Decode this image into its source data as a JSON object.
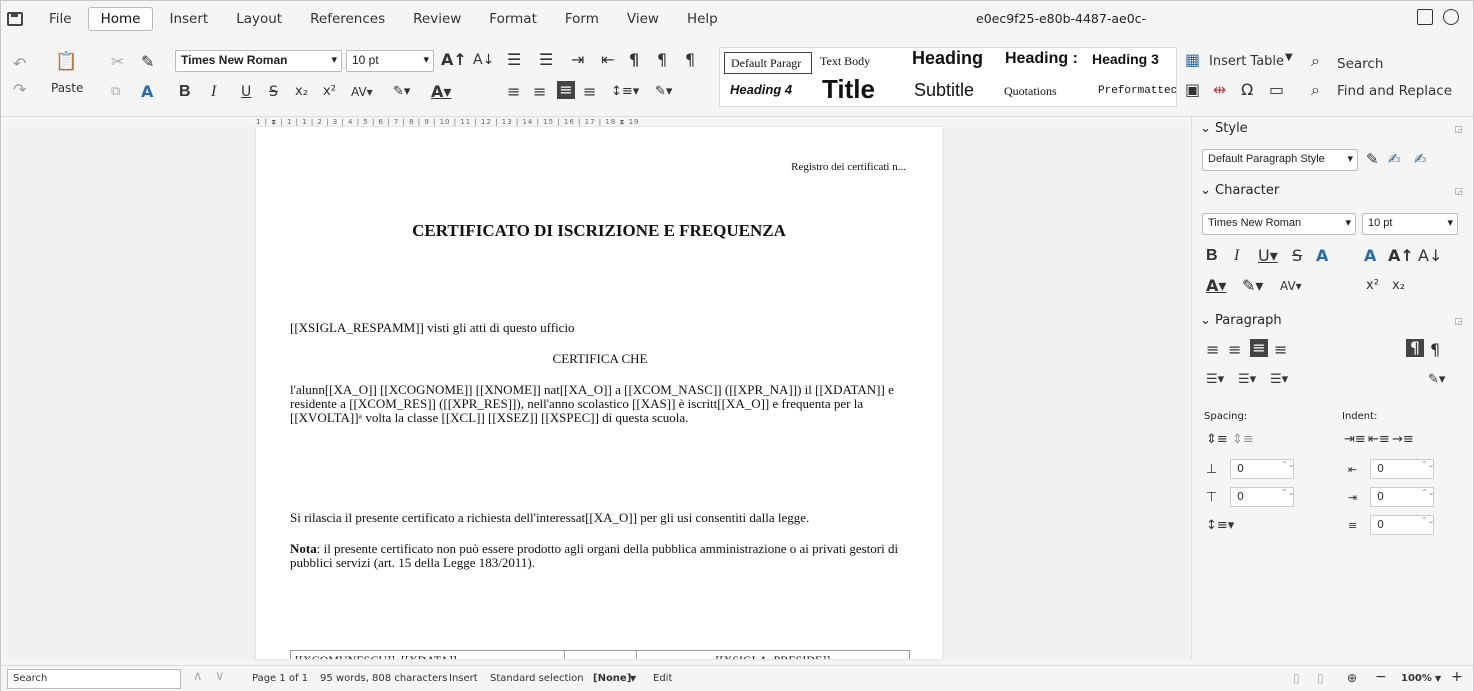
{
  "menu": {
    "items": [
      "File",
      "Home",
      "Insert",
      "Layout",
      "References",
      "Review",
      "Format",
      "Form",
      "View",
      "Help"
    ],
    "active": "Home",
    "doc_id": "e0ec9f25-e80b-4487-ae0c-"
  },
  "toolbar": {
    "paste_label": "Paste",
    "font_name": "Times New Roman",
    "font_size": "10 pt",
    "styles": {
      "default_paragraph": "Default Paragr",
      "text_body": "Text Body",
      "heading": "Heading",
      "heading2": "Heading :",
      "heading3": "Heading 3",
      "heading4": "Heading 4",
      "title": "Title",
      "subtitle": "Subtitle",
      "quotations": "Quotations",
      "preformatted": "Preformattec"
    },
    "insert_table": "Insert Table",
    "search": "Search",
    "find_replace": "Find and Replace"
  },
  "ruler": "1 | ⧗ | 1 | 1 | 2 | 3 | 4 | 5 | 6 | 7 | 8 | 9 | 10 | 11 | 12 | 13 | 14 | 15 | 16 | 17 | 18 ⧗ 19",
  "document": {
    "header": "Registro dei certificati n...",
    "title": "CERTIFICATO DI ISCRIZIONE E FREQUENZA",
    "p1": "[[XSIGLA_RESPAMM]] visti gli atti di questo ufficio",
    "p2": "CERTIFICA CHE",
    "p3": "l'alunn[[XA_O]] [[XCOGNOME]] [[XNOME]] nat[[XA_O]] a [[XCOM_NASC]] ([[XPR_NA]]) il [[XDATAN]] e residente a [[XCOM_RES]] ([[XPR_RES]]), nell'anno scolastico [[XAS]] è iscritt[[XA_O]] e frequenta per la [[XVOLTA]]ᵃ volta la classe [[XCL]]  [[XSEZ]] [[XSPEC]] di questa scuola.",
    "p4": "Si rilascia il presente certificato a richiesta dell'interessat[[XA_O]] per gli usi consentiti dalla legge.",
    "p5_bold": "Nota",
    "p5": ": il presente certificato non può essere prodotto agli organi della pubblica amministrazione o ai privati gestori di pubblici servizi (art. 15 della Legge 183/2011).",
    "table_cell1": "[[XCOMUNESCU]], [[XDATA]]",
    "table_cell3": "[[XSIGLA_PRESIDE]]"
  },
  "sidebar": {
    "style_header": "Style",
    "style_value": "Default Paragraph Style",
    "character_header": "Character",
    "font_name": "Times New Roman",
    "font_size": "10 pt",
    "paragraph_header": "Paragraph",
    "spacing_label": "Spacing:",
    "indent_label": "Indent:",
    "spin_values": [
      "0",
      "0",
      "0",
      "0",
      "0"
    ]
  },
  "status": {
    "search_placeholder": "Search",
    "page": "Page 1 of 1",
    "words": "95 words, 808 characters",
    "insert": "Insert",
    "selection": "Standard selection",
    "language": "[None]",
    "edit": "Edit",
    "zoom": "100%"
  }
}
